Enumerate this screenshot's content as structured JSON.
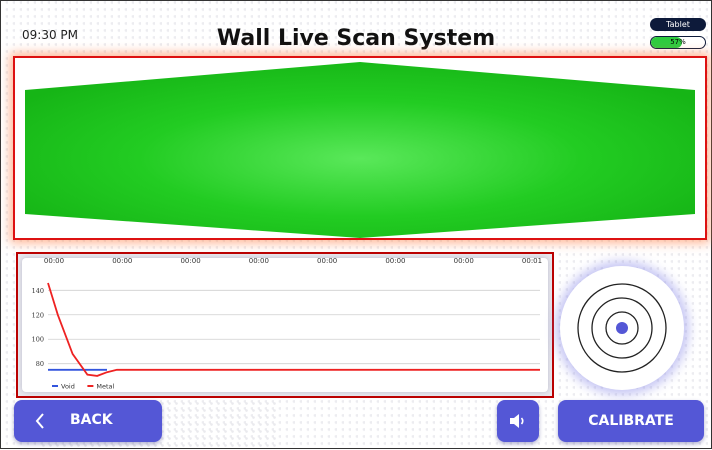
{
  "status_bar": {
    "time": "09:30 PM",
    "title": "Wall Live Scan System",
    "device": "Tablet",
    "battery_text": "57%",
    "battery_level": 0.57
  },
  "colors": {
    "accent": "#5457D6",
    "scan_fill": "#22CC22",
    "panel_border": "#D11111",
    "void_series": "#3355DD",
    "metal_series": "#EE2222",
    "battery_fill": "#2ECC40"
  },
  "chart_data": {
    "type": "line",
    "x_ticks": [
      "00:00",
      "00:00",
      "00:00",
      "00:00",
      "00:00",
      "00:00",
      "00:00",
      "00:01"
    ],
    "y_ticks": [
      80,
      100,
      120,
      140
    ],
    "ylim": [
      65,
      155
    ],
    "series": [
      {
        "name": "Void",
        "color": "#3355DD",
        "points": [
          [
            0,
            75
          ],
          [
            0.12,
            75
          ]
        ]
      },
      {
        "name": "Metal",
        "color": "#EE2222",
        "points": [
          [
            0,
            146
          ],
          [
            0.02,
            120
          ],
          [
            0.05,
            88
          ],
          [
            0.08,
            71
          ],
          [
            0.1,
            70
          ],
          [
            0.12,
            73
          ],
          [
            0.14,
            75
          ],
          [
            1.0,
            75
          ]
        ]
      }
    ],
    "legend_position": "bottom-left"
  },
  "buttons": {
    "back": "BACK",
    "calibrate": "CALIBRATE"
  },
  "icons": {
    "back": "chevron-left-icon",
    "sound": "speaker-icon",
    "radar": "radar-target-icon"
  }
}
